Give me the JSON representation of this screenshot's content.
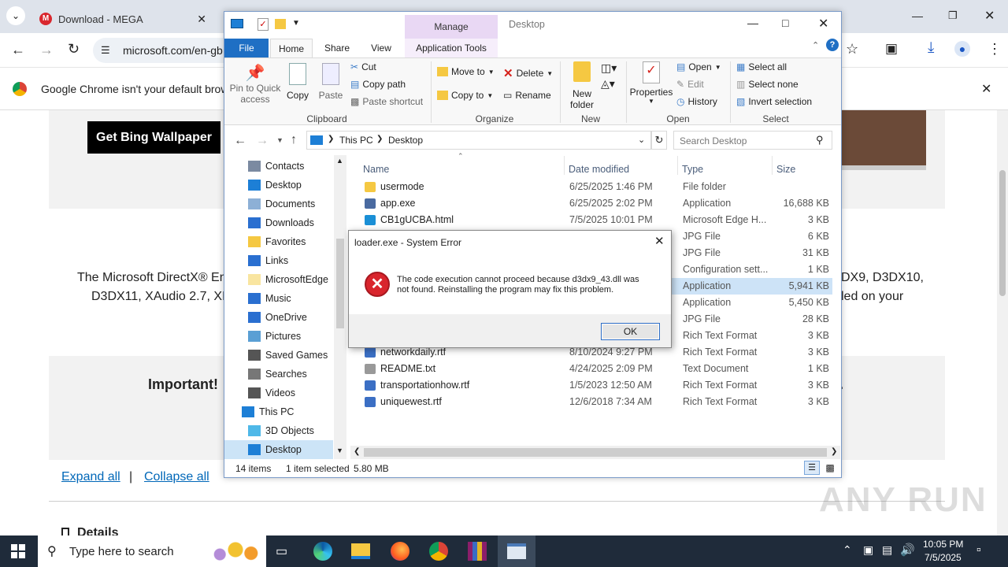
{
  "browser": {
    "tabs": [
      {
        "label": "Download - MEGA"
      }
    ],
    "address": "microsoft.com/en-gb",
    "info_bar": "Google Chrome isn't your default brows"
  },
  "page": {
    "bing_button": "Get Bing Wallpaper",
    "body_line1": "The Microsoft DirectX® En",
    "body_line2": "D3DX11, XAudio 2.7, XIn",
    "body_right1": "DX9, D3DX10,",
    "body_right2": "led on your",
    "important": "Important!",
    "expand_all": "Expand all",
    "separator": "|",
    "collapse_all": "Collapse all",
    "details": "Details"
  },
  "explorer": {
    "title": "Desktop",
    "manage_tab": "Manage",
    "app_tools_tab": "Application Tools",
    "tabs": {
      "file": "File",
      "home": "Home",
      "share": "Share",
      "view": "View"
    },
    "ribbon": {
      "pin": "Pin to Quick",
      "pin2": "access",
      "copy": "Copy",
      "paste": "Paste",
      "cut": "Cut",
      "copy_path": "Copy path",
      "paste_shortcut": "Paste shortcut",
      "clipboard": "Clipboard",
      "move_to": "Move to",
      "copy_to": "Copy to",
      "delete": "Delete",
      "rename": "Rename",
      "organize": "Organize",
      "new_folder": "New",
      "new_folder2": "folder",
      "new": "New",
      "properties": "Properties",
      "open": "Open",
      "edit": "Edit",
      "history": "History",
      "open_grp": "Open",
      "select_all": "Select all",
      "select_none": "Select none",
      "invert": "Invert selection",
      "select_grp": "Select"
    },
    "breadcrumb": {
      "this_pc": "This PC",
      "desktop": "Desktop"
    },
    "search_placeholder": "Search Desktop",
    "nav": [
      "Contacts",
      "Desktop",
      "Documents",
      "Downloads",
      "Favorites",
      "Links",
      "MicrosoftEdge",
      "Music",
      "OneDrive",
      "Pictures",
      "Saved Games",
      "Searches",
      "Videos",
      "This PC",
      "3D Objects",
      "Desktop"
    ],
    "columns": {
      "name": "Name",
      "date": "Date modified",
      "type": "Type",
      "size": "Size"
    },
    "files": [
      {
        "name": "usermode",
        "date": "6/25/2025 1:46 PM",
        "type": "File folder",
        "size": ""
      },
      {
        "name": "app.exe",
        "date": "6/25/2025 2:02 PM",
        "type": "Application",
        "size": "16,688 KB"
      },
      {
        "name": "CB1gUCBA.html",
        "date": "7/5/2025 10:01 PM",
        "type": "Microsoft Edge H...",
        "size": "3 KB"
      },
      {
        "name": "",
        "date": "",
        "type": "JPG File",
        "size": "6 KB"
      },
      {
        "name": "",
        "date": "",
        "type": "JPG File",
        "size": "31 KB"
      },
      {
        "name": "",
        "date": "",
        "type": "Configuration sett...",
        "size": "1 KB"
      },
      {
        "name": "",
        "date": "",
        "type": "Application",
        "size": "5,941 KB"
      },
      {
        "name": "",
        "date": "",
        "type": "Application",
        "size": "5,450 KB"
      },
      {
        "name": "",
        "date": "",
        "type": "JPG File",
        "size": "28 KB"
      },
      {
        "name": "",
        "date": "",
        "type": "Rich Text Format",
        "size": "3 KB"
      },
      {
        "name": "networkdaily.rtf",
        "date": "8/10/2024 9:27 PM",
        "type": "Rich Text Format",
        "size": "3 KB"
      },
      {
        "name": "README.txt",
        "date": "4/24/2025 2:09 PM",
        "type": "Text Document",
        "size": "1 KB"
      },
      {
        "name": "transportationhow.rtf",
        "date": "1/5/2023 12:50 AM",
        "type": "Rich Text Format",
        "size": "3 KB"
      },
      {
        "name": "uniquewest.rtf",
        "date": "12/6/2018 7:34 AM",
        "type": "Rich Text Format",
        "size": "3 KB"
      }
    ],
    "status": {
      "items": "14 items",
      "selected": "1 item selected",
      "size": "5.80 MB"
    }
  },
  "dialog": {
    "title": "loader.exe - System Error",
    "message1": "The code execution cannot proceed because d3dx9_43.dll was",
    "message2": "not found. Reinstalling the program may fix this problem.",
    "ok": "OK"
  },
  "taskbar": {
    "search": "Type here to search",
    "time": "10:05 PM",
    "date": "7/5/2025"
  },
  "watermark": "ANY RUN"
}
